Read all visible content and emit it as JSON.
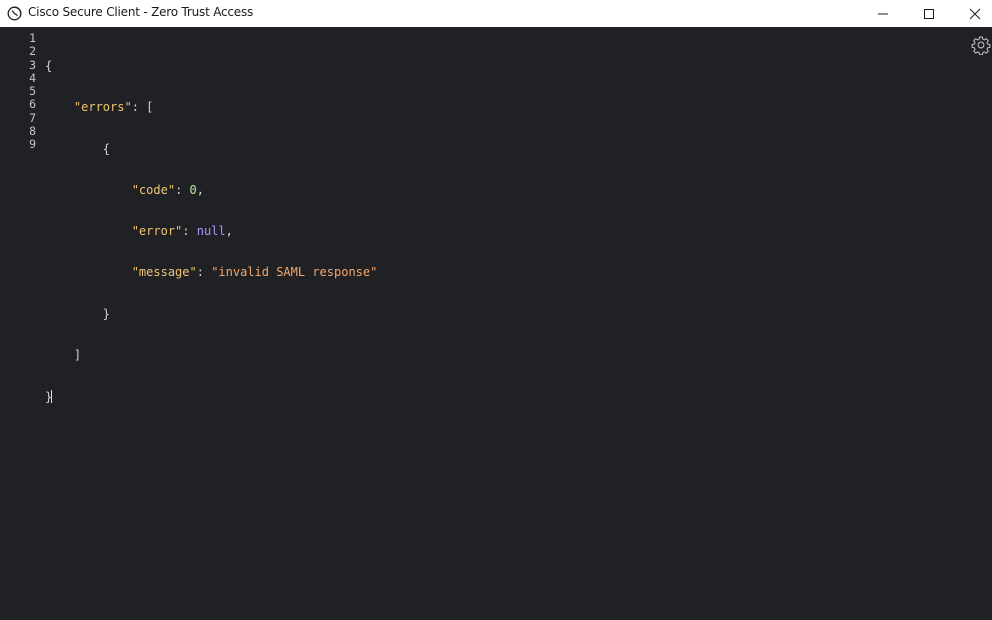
{
  "window": {
    "title": "Cisco Secure Client - Zero Trust Access",
    "icons": {
      "app": "cisco-client-icon",
      "minimize": "minimize-icon",
      "maximize": "maximize-icon",
      "close": "close-icon",
      "settings": "gear-icon"
    }
  },
  "editor": {
    "line_numbers": [
      "1",
      "2",
      "3",
      "4",
      "5",
      "6",
      "7",
      "8",
      "9"
    ],
    "lines": [
      {
        "text": "{"
      },
      {
        "indent": "    ",
        "key": "\"errors\"",
        "after": ": ["
      },
      {
        "indent": "        ",
        "text": "{"
      },
      {
        "indent": "            ",
        "key": "\"code\"",
        "sep": ": ",
        "value": "0",
        "after": ","
      },
      {
        "indent": "            ",
        "key": "\"error\"",
        "sep": ": ",
        "value": "null",
        "after": ","
      },
      {
        "indent": "            ",
        "key": "\"message\"",
        "sep": ": ",
        "value": "\"invalid SAML response\""
      },
      {
        "indent": "        ",
        "text": "}"
      },
      {
        "indent": "    ",
        "text": "]"
      },
      {
        "text": "}"
      }
    ]
  },
  "colors": {
    "background": "#202124",
    "key": "#f0c674",
    "number": "#b5e8a6",
    "null": "#b190ff",
    "string": "#f5a66b"
  }
}
